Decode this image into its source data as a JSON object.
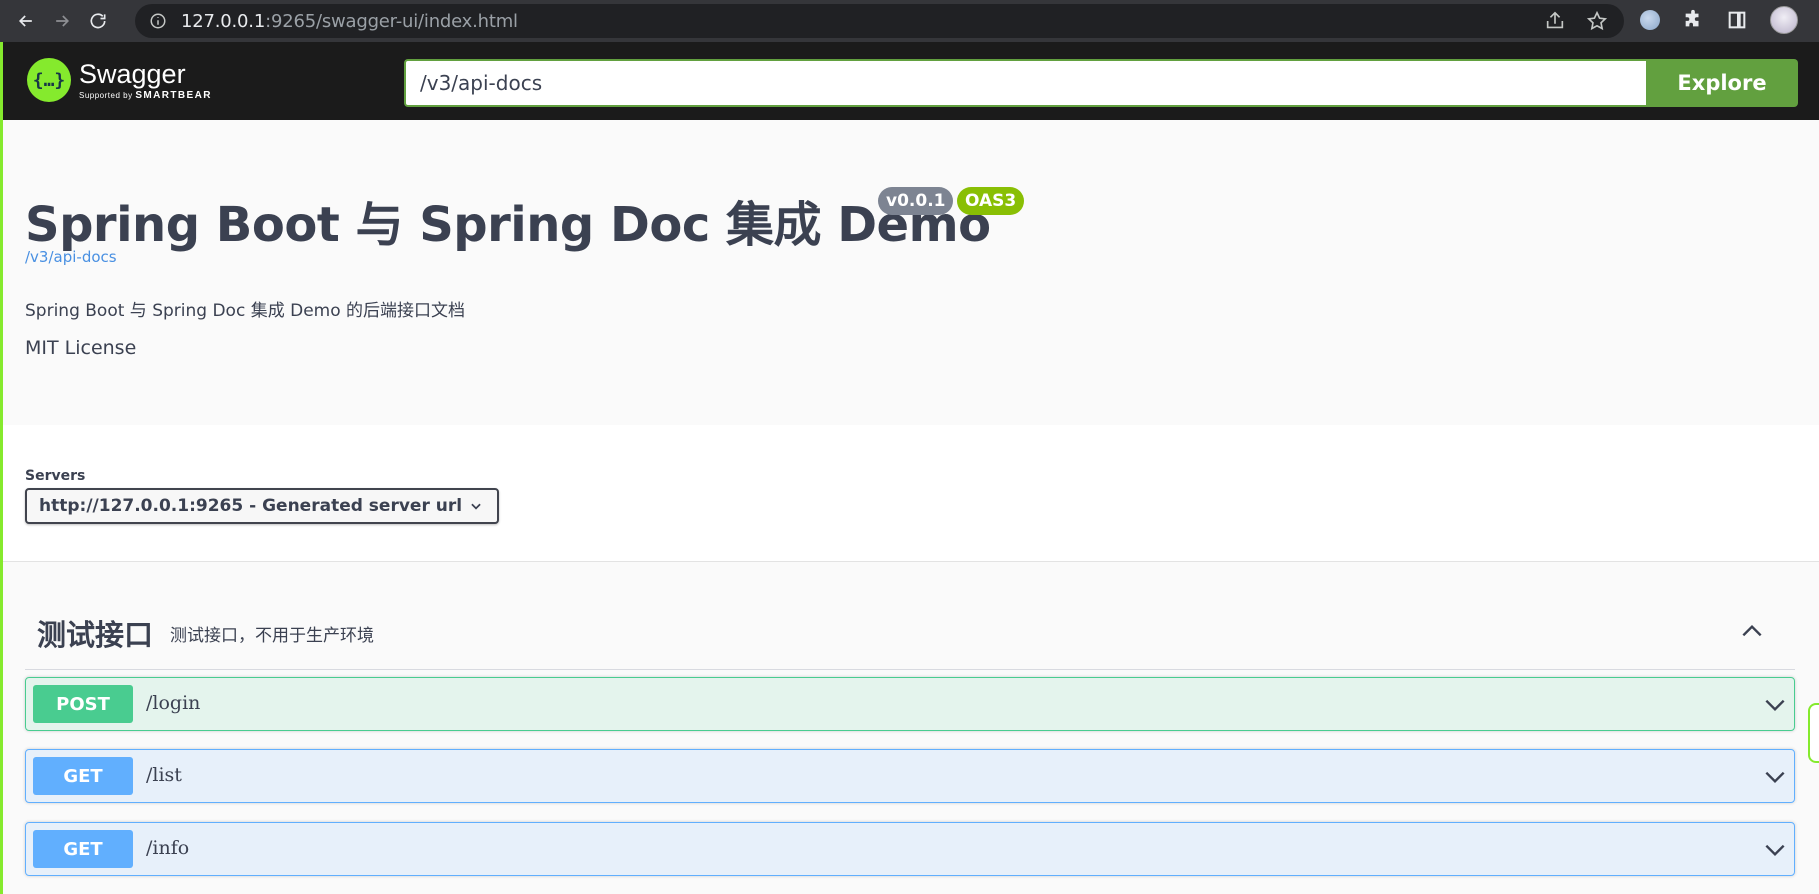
{
  "browser": {
    "url_host": "127.0.0.1",
    "url_rest": ":9265/swagger-ui/index.html"
  },
  "topbar": {
    "logo_mark": "{…}",
    "logo_name": "Swagger",
    "logo_supported_by": "Supported by",
    "logo_smartbear": "SMARTBEAR",
    "spec_url_value": "/v3/api-docs",
    "explore_label": "Explore"
  },
  "info": {
    "title": "Spring Boot 与 Spring Doc 集成 Demo",
    "version_badge": "v0.0.1",
    "oas_badge": "OAS3",
    "spec_link": "/v3/api-docs",
    "description": "Spring Boot 与 Spring Doc 集成 Demo 的后端接口文档",
    "license": "MIT License"
  },
  "servers": {
    "label": "Servers",
    "selected": "http://127.0.0.1:9265 - Generated server url"
  },
  "tag": {
    "name": "测试接口",
    "description": "测试接口，不用于生产环境"
  },
  "operations": [
    {
      "method": "POST",
      "path": "/login"
    },
    {
      "method": "GET",
      "path": "/list"
    },
    {
      "method": "GET",
      "path": "/info"
    }
  ],
  "colors": {
    "post": "#49cc90",
    "get": "#61affe",
    "explore": "#62a03f",
    "swagger_green": "#85ea2d",
    "oas_badge": "#89bf04",
    "version_badge": "#7d8492"
  }
}
